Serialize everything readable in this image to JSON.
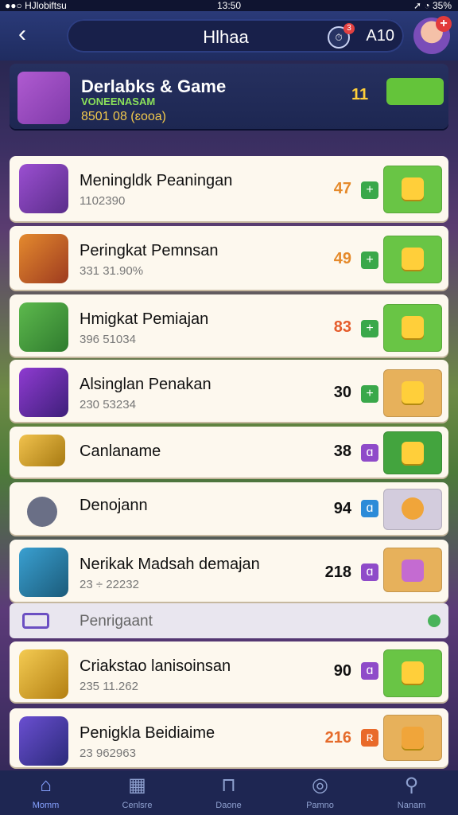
{
  "statusbar": {
    "left": "●●○ HJlobiftsu",
    "center": "13:50",
    "right": "➚ ◔ 35%"
  },
  "navbar": {
    "title": "Hlhaa",
    "counter": "A10"
  },
  "featured": {
    "name": "Derlabks & Game",
    "subtitle": "VONEENASAM",
    "meta": "8501 08 (ɛooa)",
    "value": "11"
  },
  "rows": [
    {
      "name": "Meningldk Peaningan",
      "sub": "1102390",
      "score": "47",
      "score_color": "#e58a2b",
      "mini_icon": "plus",
      "mini_color": "#3aa84a",
      "act_color": "#69c545"
    },
    {
      "name": "Peringkat Pemnsan",
      "sub": "331 31.90%",
      "score": "49",
      "score_color": "#e58a2b",
      "mini_icon": "plus",
      "mini_color": "#3aa84a",
      "act_color": "#69c545"
    },
    {
      "name": "Hmigkat Pemiajan",
      "sub": "396 51034",
      "score": "83",
      "score_color": "#e55c2b",
      "mini_icon": "plus",
      "mini_color": "#3aa84a",
      "act_color": "#69c545"
    },
    {
      "name": "Alsinglan Penakan",
      "sub": "230 53234",
      "score": "30",
      "score_color": "#111111",
      "mini_icon": "plus",
      "mini_color": "#3aa84a",
      "act_color": "#e7b15b"
    },
    {
      "name": "Canlaname",
      "sub": "",
      "score": "38",
      "score_color": "#111111",
      "mini_icon": "ɑ",
      "mini_color": "#8f4bc9",
      "act_color": "#43a43e"
    },
    {
      "name": "Denojann",
      "sub": "",
      "score": "94",
      "score_color": "#111111",
      "mini_icon": "ɑ",
      "mini_color": "#2c8bd8",
      "act_color": "#d3ccdd"
    },
    {
      "name": "Nerikak Madsah demajan",
      "sub": "23 ÷ 22232",
      "score": "218",
      "score_color": "#111111",
      "mini_icon": "ɑ",
      "mini_color": "#8f4bc9",
      "act_color": "#e7b15b"
    }
  ],
  "section": {
    "title": "Penrigaant"
  },
  "rows2": [
    {
      "name": "Criakstao lanisoinsan",
      "sub": "235 11.262",
      "score": "90",
      "score_color": "#111111",
      "mini_icon": "ɑ",
      "mini_color": "#8f4bc9",
      "act_color": "#69c545"
    },
    {
      "name": "Penigkla Beidiaime",
      "sub": "23 962963",
      "score": "216",
      "score_color": "#e56b2b",
      "mini_icon": "ʀ",
      "mini_color": "#e96a2a",
      "act_color": "#e7b15b"
    }
  ],
  "tabs": [
    "Momm",
    "Cenlsre",
    "Daone",
    "Pamno",
    "Nanam"
  ],
  "colors": {
    "accent": "#64c43a",
    "bar": "#1e2652"
  }
}
